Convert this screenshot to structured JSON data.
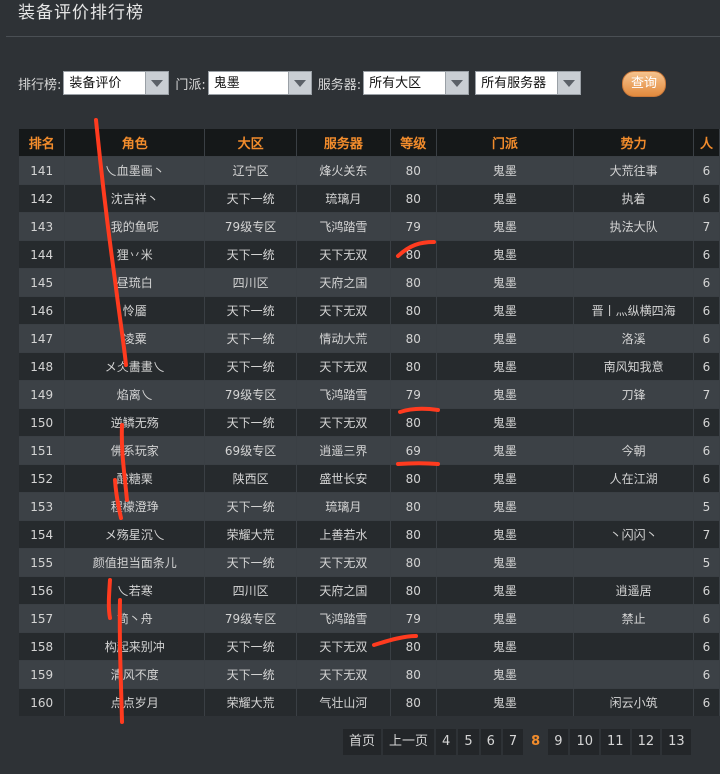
{
  "page": {
    "title": "装备评价排行榜"
  },
  "filters": {
    "ranking_label": "排行榜:",
    "ranking_value": "装备评价",
    "sect_label": "门派:",
    "sect_value": "鬼墨",
    "server_label": "服务器:",
    "region_value": "所有大区",
    "server_value": "所有服务器",
    "query_label": "查询"
  },
  "table": {
    "headers": [
      "排名",
      "角色",
      "大区",
      "服务器",
      "等级",
      "门派",
      "势力",
      "人"
    ],
    "rows": [
      [
        "141",
        "乀血墨画丶",
        "辽宁区",
        "烽火关东",
        "80",
        "鬼墨",
        "大荒往事",
        "6"
      ],
      [
        "142",
        "沈吉祥丶",
        "天下一统",
        "琉璃月",
        "80",
        "鬼墨",
        "执着",
        "6"
      ],
      [
        "143",
        "我的鱼呢",
        "79级专区",
        "飞鸿踏雪",
        "79",
        "鬼墨",
        "执法大队",
        "7"
      ],
      [
        "144",
        "狸丷米",
        "天下一统",
        "天下无双",
        "80",
        "鬼墨",
        "",
        "6"
      ],
      [
        "145",
        "昼琉白",
        "四川区",
        "天府之国",
        "80",
        "鬼墨",
        "",
        "6"
      ],
      [
        "146",
        "怜靥",
        "天下一统",
        "天下无双",
        "80",
        "鬼墨",
        "晋丨灬纵横四海",
        "6"
      ],
      [
        "147",
        "凌粟",
        "天下一统",
        "情动大荒",
        "80",
        "鬼墨",
        "洛溪",
        "6"
      ],
      [
        "148",
        "メ仌畵畫乀",
        "天下一统",
        "天下无双",
        "80",
        "鬼墨",
        "南风知我意",
        "6"
      ],
      [
        "149",
        "焰离乀",
        "79级专区",
        "飞鸿踏雪",
        "79",
        "鬼墨",
        "刀锋",
        "7"
      ],
      [
        "150",
        "逆鳞无殇",
        "天下一统",
        "天下无双",
        "80",
        "鬼墨",
        "",
        "6"
      ],
      [
        "151",
        "佛系玩家",
        "69级专区",
        "逍遥三界",
        "69",
        "鬼墨",
        "今朝",
        "6"
      ],
      [
        "152",
        "酸糖栗",
        "陕西区",
        "盛世长安",
        "80",
        "鬼墨",
        "人在江湖",
        "6"
      ],
      [
        "153",
        "程檬澄琤",
        "天下一统",
        "琉璃月",
        "80",
        "鬼墨",
        "",
        "5"
      ],
      [
        "154",
        "メ殇星沉乀",
        "荣耀大荒",
        "上善若水",
        "80",
        "鬼墨",
        "丶闪闪丶",
        "7"
      ],
      [
        "155",
        "颜值担当面条儿",
        "天下一统",
        "天下无双",
        "80",
        "鬼墨",
        "",
        "5"
      ],
      [
        "156",
        "乀若寒",
        "四川区",
        "天府之国",
        "80",
        "鬼墨",
        "逍遥居",
        "6"
      ],
      [
        "157",
        "简丶舟",
        "79级专区",
        "飞鸿踏雪",
        "79",
        "鬼墨",
        "禁止",
        "6"
      ],
      [
        "158",
        "构起来别冲",
        "天下一统",
        "天下无双",
        "80",
        "鬼墨",
        "",
        "6"
      ],
      [
        "159",
        "清风不度",
        "天下一统",
        "天下无双",
        "80",
        "鬼墨",
        "",
        "6"
      ],
      [
        "160",
        "点点岁月",
        "荣耀大荒",
        "气壮山河",
        "80",
        "鬼墨",
        "闲云小筑",
        "6"
      ]
    ]
  },
  "pagination": {
    "first": "首页",
    "prev": "上一页",
    "pages": [
      "4",
      "5",
      "6",
      "7",
      "8",
      "9",
      "10",
      "11",
      "12",
      "13"
    ],
    "current": "8"
  },
  "colors": {
    "background": "#2e3236",
    "header_text": "#f28c2c",
    "annotation": "#ff3b1f"
  }
}
